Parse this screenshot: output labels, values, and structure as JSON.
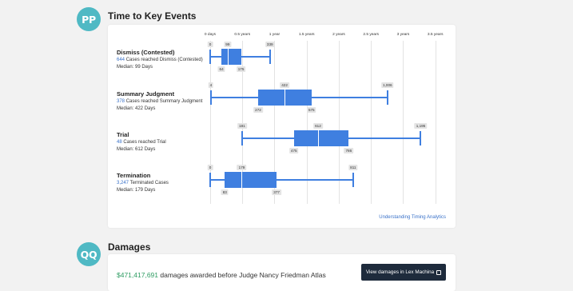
{
  "section1": {
    "avatar": "PP",
    "title": "Time to Key Events"
  },
  "axis": [
    "0 days",
    "0.5 years",
    "1 year",
    "1.5 years",
    "2 years",
    "2.5 years",
    "3 years",
    "3.5 years"
  ],
  "rows": [
    {
      "name": "Dismiss (Contested)",
      "count": "644",
      "count_text": "Cases reached Dismiss (Contested)",
      "median_text": "Median: 99 Days",
      "min": 0,
      "q1": 64,
      "median": 99,
      "q3": 175,
      "max": 339,
      "min_label": "0",
      "q1_label": "64",
      "median_label": "99",
      "q3_label": "175",
      "max_label": "339"
    },
    {
      "name": "Summary Judgment",
      "count": "378",
      "count_text": "Cases reached Summary Judgment",
      "median_text": "Median: 422 Days",
      "min": 4,
      "q1": 272,
      "median": 422,
      "q3": 575,
      "max": 1006,
      "min_label": "4",
      "q1_label": "272",
      "median_label": "422",
      "q3_label": "575",
      "max_label": "1,006"
    },
    {
      "name": "Trial",
      "count": "48",
      "count_text": "Cases reached Trial",
      "median_text": "Median: 612 Days",
      "min": 181,
      "q1": 475,
      "median": 612,
      "q3": 786,
      "max": 1195,
      "min_label": "181",
      "q1_label": "475",
      "median_label": "612",
      "q3_label": "786",
      "max_label": "1,195"
    },
    {
      "name": "Termination",
      "count": "3,247",
      "count_text": "Terminated Cases",
      "median_text": "Median: 179 Days",
      "min": 0,
      "q1": 83,
      "median": 179,
      "q3": 377,
      "max": 811,
      "min_label": "0",
      "q1_label": "83",
      "median_label": "179",
      "q3_label": "377",
      "max_label": "811"
    }
  ],
  "timing_link": "Understanding Timing Analytics",
  "section2": {
    "avatar": "QQ",
    "title": "Damages"
  },
  "damages": {
    "amount": "$471,417,691",
    "text": " damages awarded before Judge Nancy Friedman Atlas",
    "button": "View damages in Lex Machina"
  },
  "colors": {
    "accent": "#3f7fe0",
    "avatar": "#4fb9c4",
    "link": "#3a72c9",
    "money": "#2e9c62",
    "button": "#1e2b3c"
  }
}
